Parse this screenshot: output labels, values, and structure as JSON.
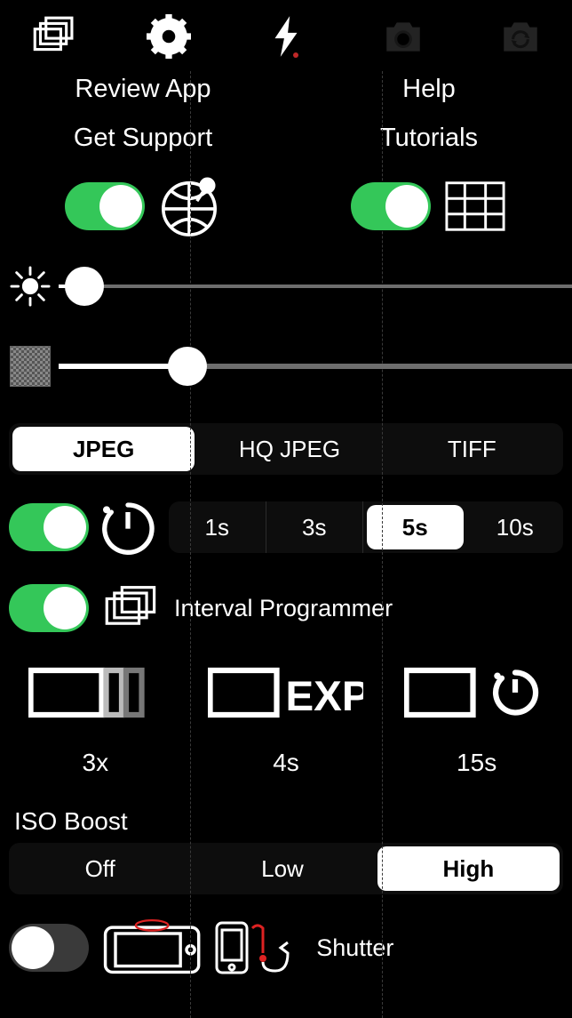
{
  "topbar": {
    "icons": [
      "gallery-icon",
      "gear-icon",
      "flash-icon",
      "camera-icon",
      "camera-switch-icon"
    ]
  },
  "links": {
    "review_app": "Review App",
    "help": "Help",
    "get_support": "Get Support",
    "tutorials": "Tutorials"
  },
  "toggles": {
    "geotag_on": true,
    "grid_on": true,
    "timer_on": true,
    "interval_on": true,
    "shutter_on": false
  },
  "sliders": {
    "brightness": {
      "pct": 5
    },
    "noise": {
      "pct": 25
    }
  },
  "format": {
    "options": [
      "JPEG",
      "HQ JPEG",
      "TIFF"
    ],
    "selected": "JPEG"
  },
  "timer": {
    "options": [
      "1s",
      "3s",
      "5s",
      "10s"
    ],
    "selected": "5s"
  },
  "interval": {
    "label": "Interval Programmer",
    "frames": "3x",
    "exposure": "4s",
    "wait": "15s"
  },
  "iso": {
    "label": "ISO Boost",
    "options": [
      "Off",
      "Low",
      "High"
    ],
    "selected": "High"
  },
  "shutter": {
    "label": "Shutter"
  },
  "colors": {
    "switch_on": "#34c759",
    "switch_off": "#3a3a3a",
    "accent_red": "#c02828"
  }
}
